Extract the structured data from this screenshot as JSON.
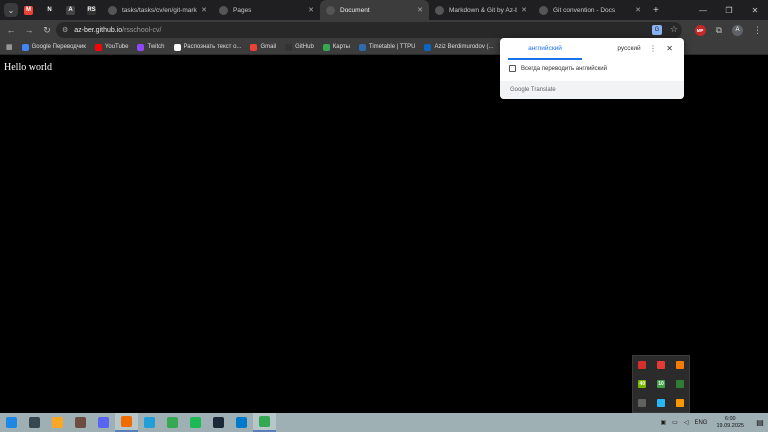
{
  "tabs": {
    "pinned": [
      {
        "icon": "gmail-icon",
        "label": "M",
        "color": "#ea4335"
      },
      {
        "icon": "notion-icon",
        "label": "N",
        "color": "#222222"
      },
      {
        "icon": "a-icon",
        "label": "A",
        "color": "#444444"
      },
      {
        "icon": "rs-icon",
        "label": "RS",
        "color": "#333333"
      }
    ],
    "items": [
      {
        "title": "tasks/tasks/cv/en/git-markd",
        "active": false
      },
      {
        "title": "Pages",
        "active": false
      },
      {
        "title": "Document",
        "active": true
      },
      {
        "title": "Markdown & Git by Az-ber",
        "active": false
      },
      {
        "title": "Git convention - Docs",
        "active": false
      }
    ]
  },
  "address": {
    "host": "az-ber.github.io",
    "path": "/rsschool-cv/"
  },
  "toolbar": {
    "extension_label": "MP",
    "profile_initial": "A"
  },
  "bookmarks": [
    {
      "label": "Google Переводчик",
      "icon": "google-translate-icon",
      "color": "#4285f4"
    },
    {
      "label": "YouTube",
      "icon": "youtube-icon",
      "color": "#ff0000"
    },
    {
      "label": "Twitch",
      "icon": "twitch-icon",
      "color": "#9146ff"
    },
    {
      "label": "Распознать текст о...",
      "icon": "ocr-icon",
      "color": "#ffffff"
    },
    {
      "label": "Gmail",
      "icon": "gmail-icon",
      "color": "#ea4335"
    },
    {
      "label": "GitHub",
      "icon": "github-icon",
      "color": "#333333"
    },
    {
      "label": "Карты",
      "icon": "maps-icon",
      "color": "#34a853"
    },
    {
      "label": "Timetable | TTPU",
      "icon": "timetable-icon",
      "color": "#2b6cb0"
    },
    {
      "label": "Aziz Berdimurodov (...",
      "icon": "linkedin-icon",
      "color": "#0a66c2"
    }
  ],
  "page": {
    "heading": "Hello world"
  },
  "translate": {
    "source_lang": "английский",
    "target_lang": "русский",
    "always_translate": "Всегда переводить английский",
    "brand": "Google Translate"
  },
  "tray_popup": [
    {
      "icon": "app1-icon",
      "color": "#d32f2f",
      "label": ""
    },
    {
      "icon": "arrow-icon",
      "color": "#e53935",
      "label": ""
    },
    {
      "icon": "orange-icon",
      "color": "#f57c00",
      "label": ""
    },
    {
      "icon": "nvidia-icon",
      "color": "#76b900",
      "label": "40"
    },
    {
      "icon": "cpu-icon",
      "color": "#43a047",
      "label": "10"
    },
    {
      "icon": "green-icon",
      "color": "#2e7d32",
      "label": ""
    },
    {
      "icon": "monitor-icon",
      "color": "#616161",
      "label": ""
    },
    {
      "icon": "blue-icon",
      "color": "#29b6f6",
      "label": ""
    },
    {
      "icon": "fire-icon",
      "color": "#ff9800",
      "label": ""
    }
  ],
  "taskbar": {
    "items": [
      {
        "icon": "windows-icon",
        "color": "#1e88e5",
        "active": false
      },
      {
        "icon": "search-icon",
        "color": "#37474f",
        "active": false
      },
      {
        "icon": "folder-icon",
        "color": "#f9a825",
        "active": false
      },
      {
        "icon": "app-icon",
        "color": "#6d4c41",
        "active": false
      },
      {
        "icon": "discord-icon",
        "color": "#5865f2",
        "active": false
      },
      {
        "icon": "fire-app-icon",
        "color": "#ef6c00",
        "active": true
      },
      {
        "icon": "telegram-icon",
        "color": "#229ed9",
        "active": false
      },
      {
        "icon": "chrome-icon",
        "color": "#34a853",
        "active": false
      },
      {
        "icon": "spotify-icon",
        "color": "#1db954",
        "active": false
      },
      {
        "icon": "steam-icon",
        "color": "#1b2838",
        "active": false
      },
      {
        "icon": "vscode-icon",
        "color": "#007acc",
        "active": false
      },
      {
        "icon": "chrome-active-icon",
        "color": "#34a853",
        "active": true
      }
    ],
    "lang": "ENG",
    "time": "6:00",
    "date": "19.09.2025"
  }
}
